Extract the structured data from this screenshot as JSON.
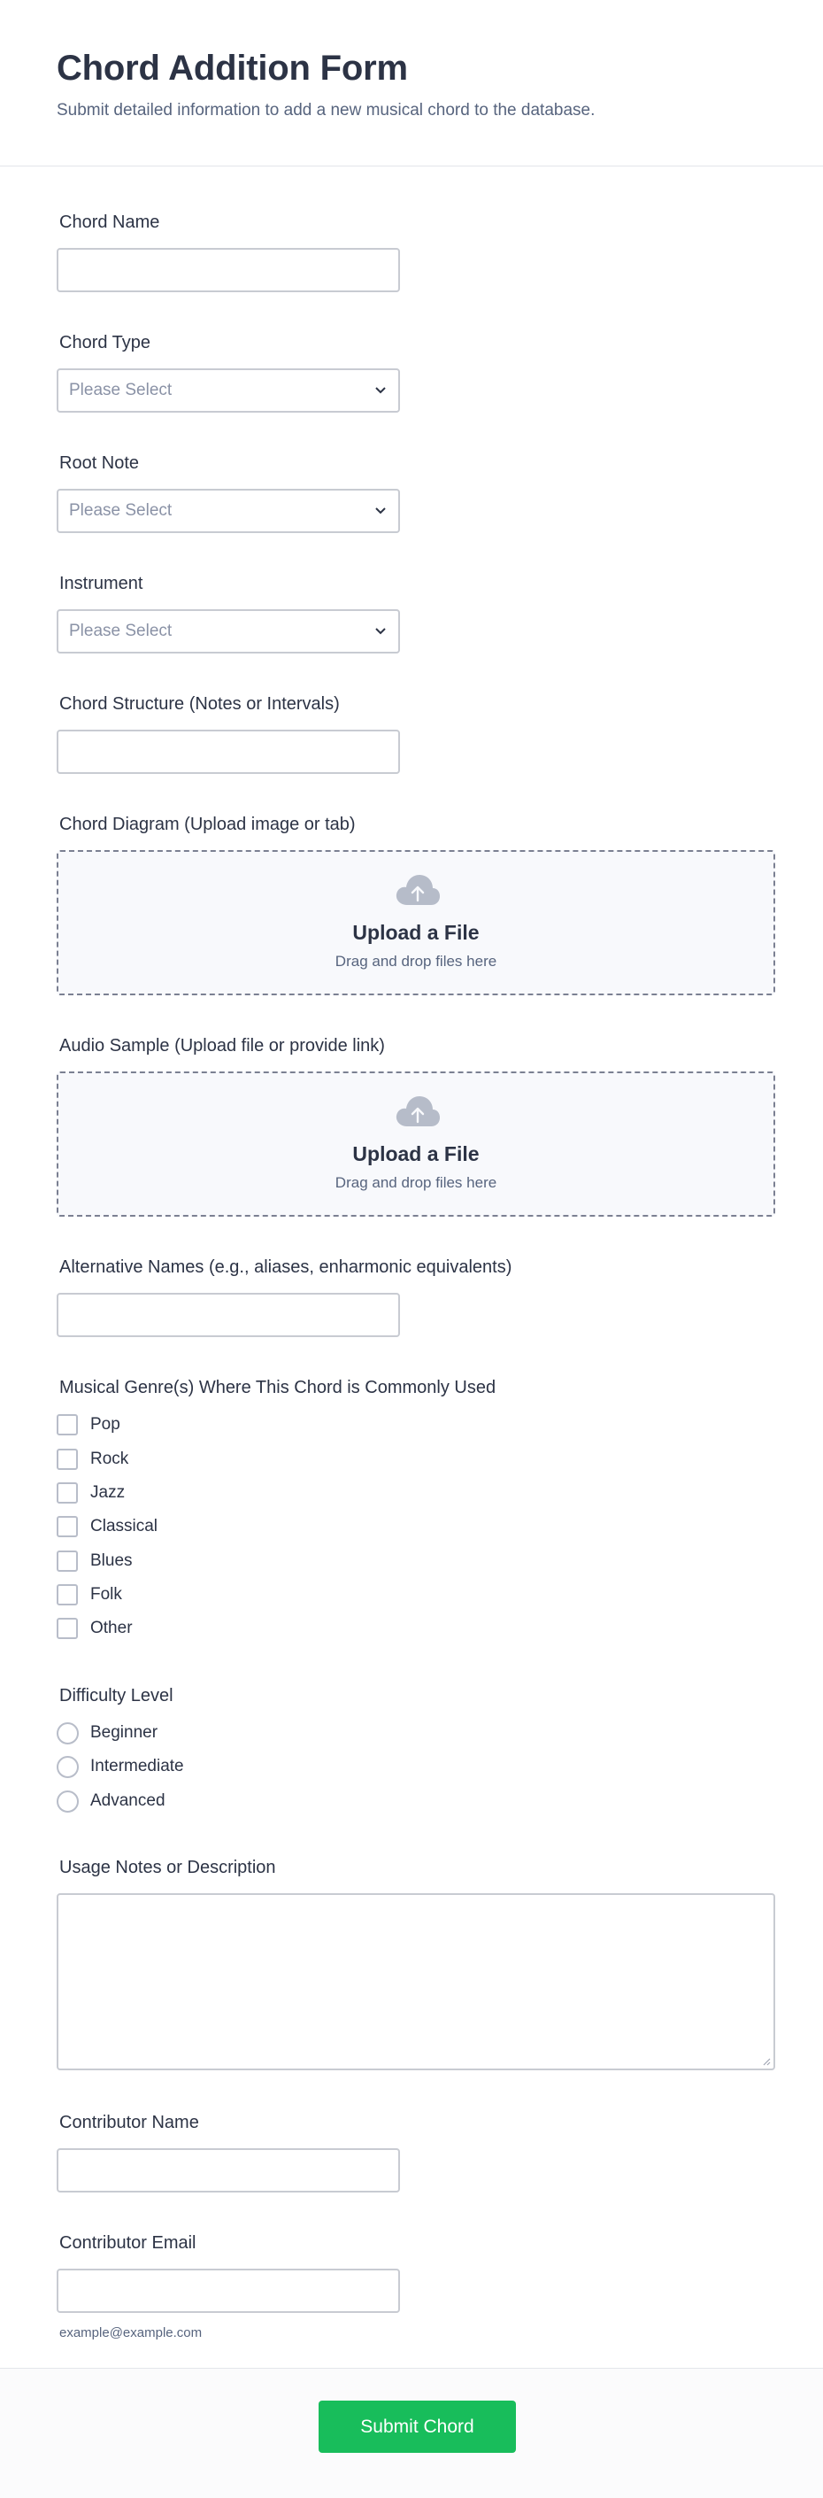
{
  "header": {
    "title": "Chord Addition Form",
    "subtitle": "Submit detailed information to add a new musical chord to the database."
  },
  "fields": {
    "chord_name": {
      "label": "Chord Name",
      "value": ""
    },
    "chord_type": {
      "label": "Chord Type",
      "placeholder": "Please Select"
    },
    "root_note": {
      "label": "Root Note",
      "placeholder": "Please Select"
    },
    "instrument": {
      "label": "Instrument",
      "placeholder": "Please Select"
    },
    "chord_structure": {
      "label": "Chord Structure (Notes or Intervals)",
      "value": ""
    },
    "chord_diagram": {
      "label": "Chord Diagram (Upload image or tab)",
      "upload_title": "Upload a File",
      "upload_sub": "Drag and drop files here"
    },
    "audio_sample": {
      "label": "Audio Sample (Upload file or provide link)",
      "upload_title": "Upload a File",
      "upload_sub": "Drag and drop files here"
    },
    "alternative_names": {
      "label": "Alternative Names (e.g., aliases, enharmonic equivalents)",
      "value": ""
    },
    "genres": {
      "label": "Musical Genre(s) Where This Chord is Commonly Used",
      "options": [
        "Pop",
        "Rock",
        "Jazz",
        "Classical",
        "Blues",
        "Folk",
        "Other"
      ]
    },
    "difficulty": {
      "label": "Difficulty Level",
      "options": [
        "Beginner",
        "Intermediate",
        "Advanced"
      ]
    },
    "usage_notes": {
      "label": "Usage Notes or Description",
      "value": ""
    },
    "contributor_name": {
      "label": "Contributor Name",
      "value": ""
    },
    "contributor_email": {
      "label": "Contributor Email",
      "value": "",
      "hint": "example@example.com"
    }
  },
  "submit": {
    "label": "Submit Chord"
  },
  "colors": {
    "accent": "#18bd5b",
    "text": "#2c3345",
    "muted": "#57647e",
    "border": "#c8cbd2"
  }
}
